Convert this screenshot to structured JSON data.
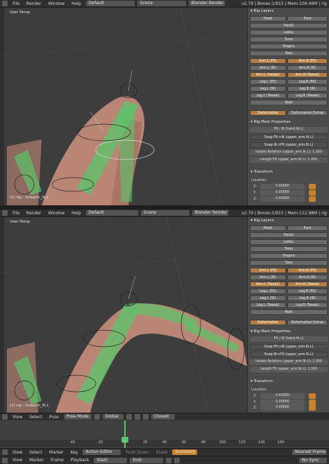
{
  "top": {
    "menu": [
      "File",
      "Render",
      "Window",
      "Help"
    ],
    "layout": "Default",
    "scene": "Scene",
    "engine": "Blender Render",
    "stats": "v2.79 | Bones:1/915 | Mem:109.46M | rig"
  },
  "bottom": {
    "menu": [
      "File",
      "Render",
      "Window",
      "Help"
    ],
    "layout": "Default",
    "scene": "Scene",
    "engine": "Blender Render",
    "stats": "v2.79 | Bones:1/915 | Mem:112.98M | rig"
  },
  "viewport_top": {
    "label": "User Persp",
    "status": "(1) rig : forearm_fk.L"
  },
  "viewport_bottom": {
    "label": "User Persp",
    "status": "(1) rig : forearm_fk.L"
  },
  "rig_layers": {
    "title": "Rig Layers",
    "rows": [
      [
        "Head",
        "Face"
      ],
      [
        "Face2"
      ],
      [
        "Lekku"
      ],
      [
        "Torso"
      ],
      [
        "Fingers"
      ],
      [
        "Toes"
      ],
      [
        "Arm.L (FK)",
        "Arm.R (FK)"
      ],
      [
        "Arm.L (IK)",
        "Arm.R (IK)"
      ],
      [
        "Arm.L (Tweak)",
        "Arm.R (Tweak)"
      ],
      [
        "Leg.L (FK)",
        "Leg.R (FK)"
      ],
      [
        "Leg.L (IK)",
        "Leg.R (IK)"
      ],
      [
        "Leg.L (Tweak)",
        "Leg.R (Tweak)"
      ],
      [
        "Root"
      ],
      [
        "Deformation",
        "Deformation Extras"
      ]
    ]
  },
  "rig_main": {
    "title": "Rig Main Properties",
    "fk_ik": "FK / IK (hand.fk.L)",
    "snap_fk_ik": "Snap FK->IK (upper_arm.fk.L)",
    "snap_ik_fk": "Snap IK->FK (upper_arm.fk.L)",
    "isolate": "Isolate Rotation (upper_arm.fk.L): 1.000",
    "length": "Length FK (upper_arm.fk.L): 1.000"
  },
  "transform": {
    "title": "Transform",
    "location_label": "Location:",
    "x": "X:",
    "y": "Y:",
    "z": "Z:",
    "xv": "0.00000",
    "yv": "0.00000",
    "zv": "0.00000"
  },
  "view3d_header": {
    "items": [
      "View",
      "Select",
      "Pose",
      "Pose Mode",
      "Global",
      "Closest"
    ]
  },
  "timeline": {
    "ticks": [
      "-40",
      "-20",
      "0",
      "20",
      "40",
      "60",
      "80",
      "100",
      "120",
      "140",
      "160"
    ],
    "items": [
      "View",
      "Select",
      "Marker",
      "Key",
      "Action Editor",
      "Push Down",
      "Stash",
      "Summary",
      "Nearest Frame"
    ],
    "items2": [
      "View",
      "Marker",
      "Frame",
      "Playback",
      "Start:",
      "End:",
      "No Sync"
    ]
  },
  "colors": {
    "accent": "#c8822c",
    "bone": "#5bc46a",
    "skin": "#c08878",
    "active": "#b27d45"
  }
}
